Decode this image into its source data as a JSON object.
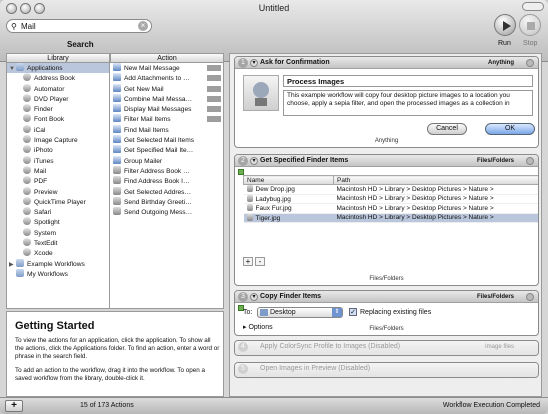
{
  "window": {
    "title": "Untitled",
    "run_label": "Run",
    "stop_label": "Stop"
  },
  "search": {
    "value": "Mail",
    "label": "Search",
    "clear_glyph": "×"
  },
  "library": {
    "header": "Library",
    "items": [
      {
        "label": "Applications",
        "kind": "folder",
        "expanded": true,
        "selected": true,
        "indent": 0
      },
      {
        "label": "Address Book",
        "kind": "app",
        "indent": 1
      },
      {
        "label": "Automator",
        "kind": "app",
        "indent": 1
      },
      {
        "label": "DVD Player",
        "kind": "app",
        "indent": 1
      },
      {
        "label": "Finder",
        "kind": "app",
        "indent": 1
      },
      {
        "label": "Font Book",
        "kind": "app",
        "indent": 1
      },
      {
        "label": "iCal",
        "kind": "app",
        "indent": 1
      },
      {
        "label": "Image Capture",
        "kind": "app",
        "indent": 1
      },
      {
        "label": "iPhoto",
        "kind": "app",
        "indent": 1
      },
      {
        "label": "iTunes",
        "kind": "app",
        "indent": 1
      },
      {
        "label": "Mail",
        "kind": "app",
        "indent": 1
      },
      {
        "label": "PDF",
        "kind": "app",
        "indent": 1
      },
      {
        "label": "Preview",
        "kind": "app",
        "indent": 1
      },
      {
        "label": "QuickTime Player",
        "kind": "app",
        "indent": 1
      },
      {
        "label": "Safari",
        "kind": "app",
        "indent": 1
      },
      {
        "label": "Spotlight",
        "kind": "app",
        "indent": 1
      },
      {
        "label": "System",
        "kind": "app",
        "indent": 1
      },
      {
        "label": "TextEdit",
        "kind": "app",
        "indent": 1
      },
      {
        "label": "Xcode",
        "kind": "app",
        "indent": 1
      },
      {
        "label": "Example Workflows",
        "kind": "folder",
        "expanded": false,
        "indent": 0
      },
      {
        "label": "My Workflows",
        "kind": "folder",
        "indent": 0
      }
    ]
  },
  "actions": {
    "header": "Action",
    "items": [
      "New Mail Message",
      "Add Attachments to …",
      "Get New Mail",
      "Combine Mail Messa…",
      "Display Mail Messages",
      "Filter Mail Items",
      "Find Mail Items",
      "Get Selected Mail Items",
      "Get Specified Mail Ite…",
      "Group Mailer",
      "Filter Address Book …",
      "Find Address Book I…",
      "Get Selected Addres…",
      "Send Birthday Greeti…",
      "Send Outgoing Mess…"
    ]
  },
  "description": {
    "title": "Getting Started",
    "para1": "To view the actions for an application, click the application. To show all the actions, click the Applications folder. To find an action, enter a word or phrase in the search field.",
    "para2": "To add an action to the workflow, drag it into the workflow. To open a saved workflow from the library, double-click it."
  },
  "bottom": {
    "add_glyph": "+",
    "count": "15 of 173 Actions",
    "status": "Workflow Execution Completed"
  },
  "workflow": {
    "step1": {
      "num": "1",
      "title": "Ask for Confirmation",
      "type": "Anything",
      "heading": "Process Images",
      "message": "This example workflow will copy four desktop picture images to a location you choose, apply a sepia filter, and open the processed images as a collection in",
      "cancel": "Cancel",
      "ok": "OK",
      "footer": "Anything"
    },
    "step2": {
      "num": "2",
      "title": "Get Specified Finder Items",
      "type": "Files/Folders",
      "col_name": "Name",
      "col_path": "Path",
      "files": [
        {
          "name": "Dew Drop.jpg",
          "path": "Macintosh HD > Library > Desktop Pictures > Nature >"
        },
        {
          "name": "Ladybug.jpg",
          "path": "Macintosh HD > Library > Desktop Pictures > Nature >"
        },
        {
          "name": "Faux Fur.jpg",
          "path": "Macintosh HD > Library > Desktop Pictures > Nature >"
        },
        {
          "name": "Tiger.jpg",
          "path": "Macintosh HD > Library > Desktop Pictures > Nature >"
        }
      ],
      "add": "+",
      "remove": "-",
      "footer": "Files/Folders"
    },
    "step3": {
      "num": "3",
      "title": "Copy Finder Items",
      "type": "Files/Folders",
      "to_label": "To:",
      "to_value": "Desktop",
      "replace_label": "Replacing existing files",
      "options": "Options",
      "footer": "Files/Folders"
    },
    "step4": {
      "num": "4",
      "title": "Apply ColorSync Profile to Images (Disabled)",
      "type": "Image files"
    },
    "step5": {
      "num": "5",
      "title": "Open Images in Preview (Disabled)"
    }
  },
  "colors": {
    "selection": "#b9c6db",
    "accent": "#7aa6e6"
  }
}
